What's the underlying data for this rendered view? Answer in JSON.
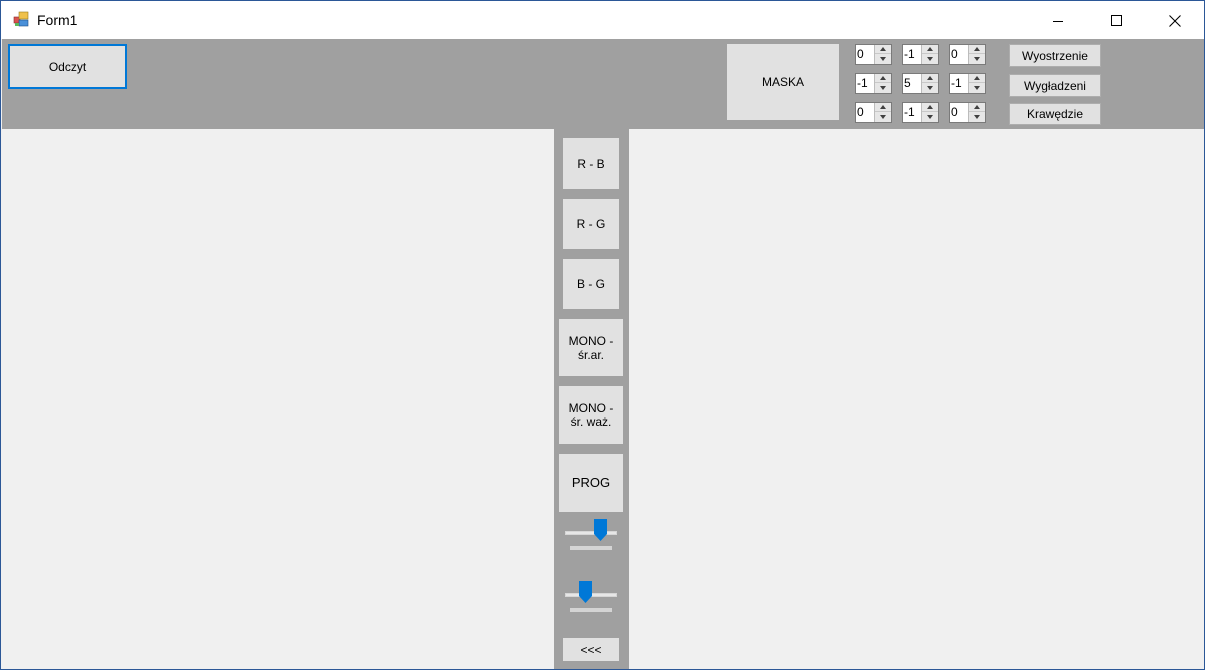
{
  "window": {
    "title": "Form1",
    "buttons": {
      "minimize": "minimize",
      "maximize": "maximize",
      "close": "close"
    }
  },
  "toolbar": {
    "read_label": "Odczyt",
    "mask_label": "MASKA",
    "mask_values": [
      [
        "0",
        "-1",
        "0"
      ],
      [
        "-1",
        "5",
        "-1"
      ],
      [
        "0",
        "-1",
        "0"
      ]
    ],
    "filter_buttons": [
      "Wyostrzenie",
      "Wygładzeni",
      "Krawędzie"
    ]
  },
  "strip": {
    "rb_label": "R - B",
    "rg_label": "R - G",
    "bg_label": "B - G",
    "mono_avg_label": "MONO - śr.ar.",
    "mono_weighted_label": "MONO - śr. waż.",
    "threshold_label": "PROG",
    "back_label": "<<<",
    "slider1_level": 0.75,
    "slider2_level": 0.35
  },
  "colors": {
    "panel": "#a0a0a0",
    "button": "#e1e1e1",
    "accent": "#0078d7",
    "background": "#f0f0f0"
  }
}
